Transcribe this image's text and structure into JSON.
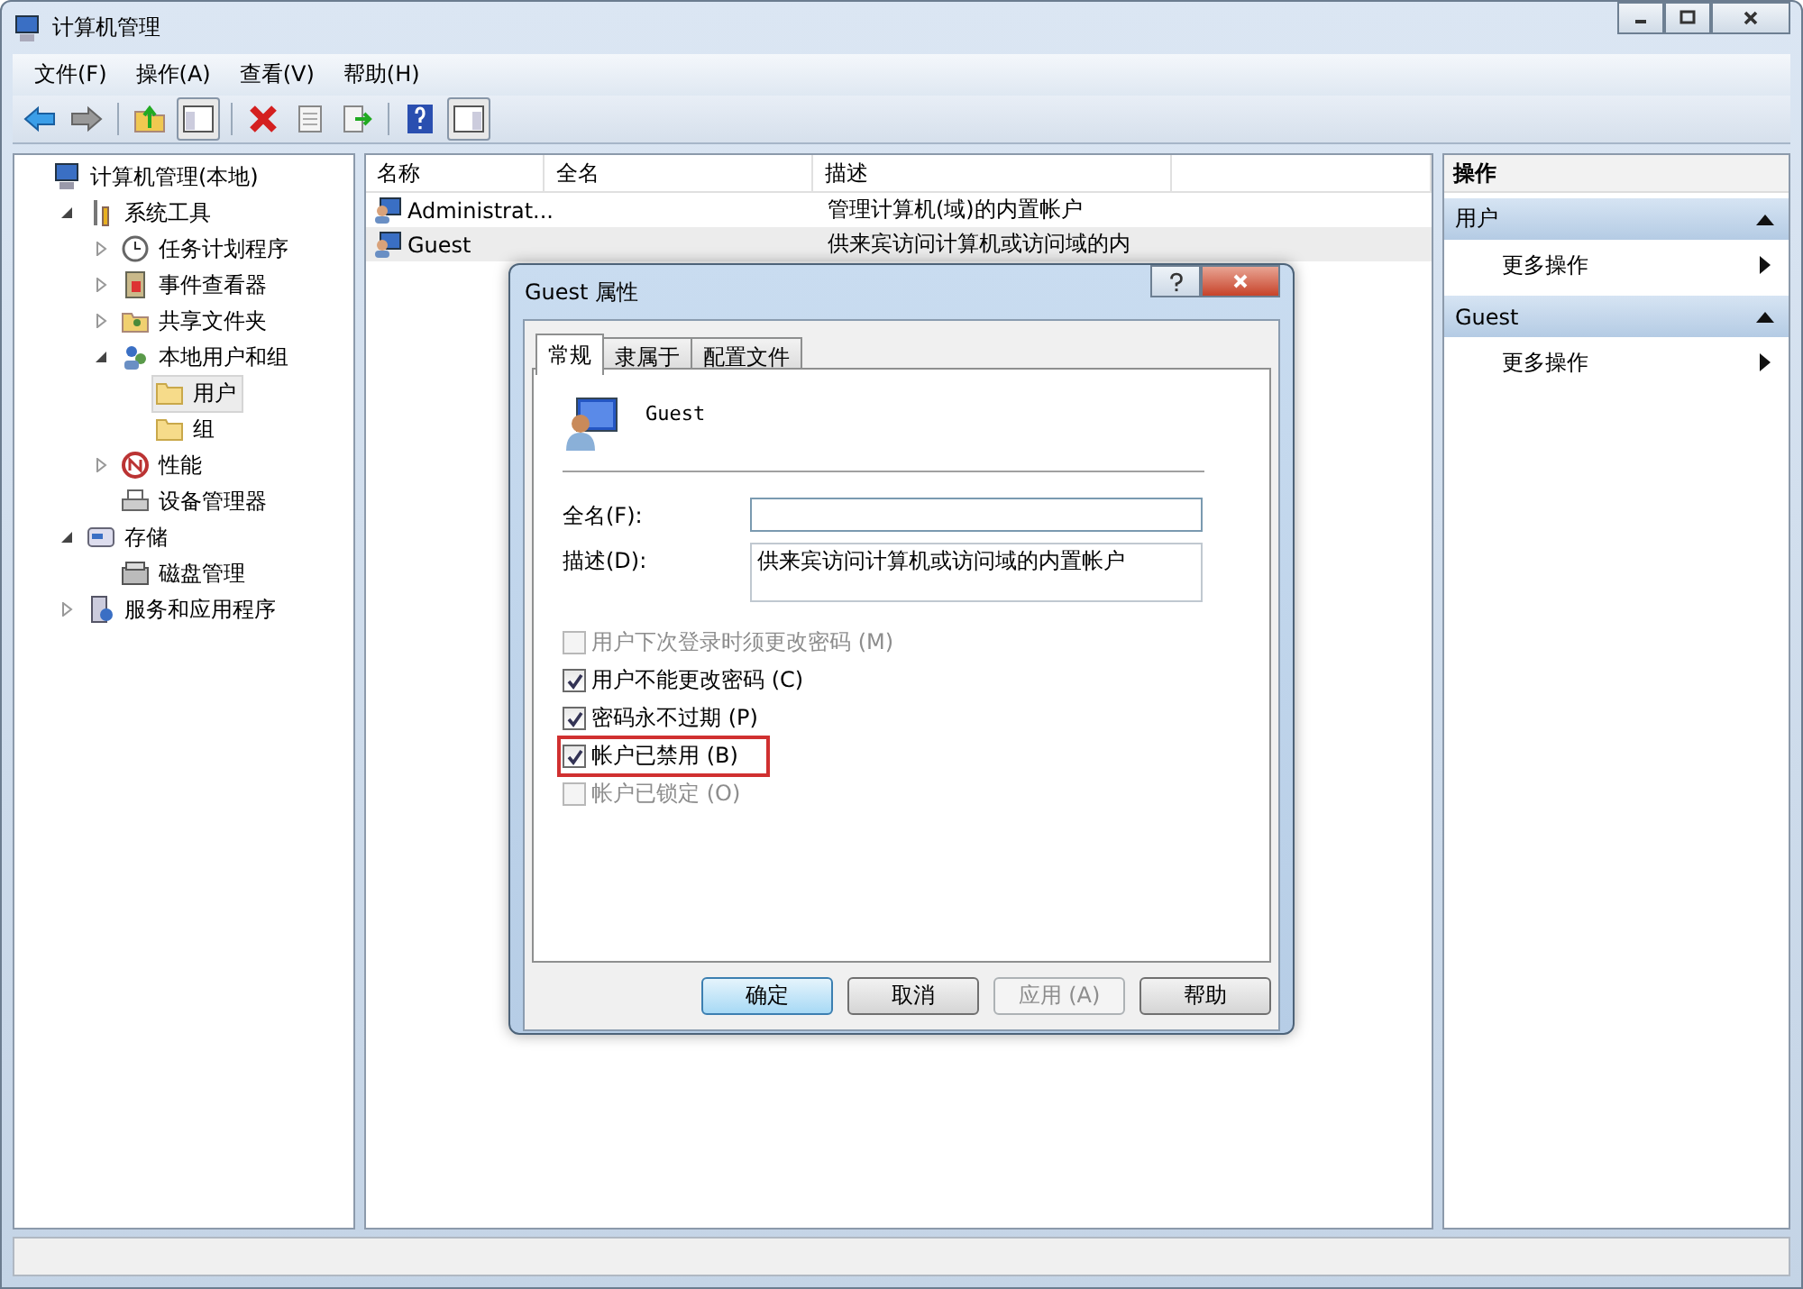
{
  "window": {
    "title": "计算机管理"
  },
  "menu": [
    "文件(F)",
    "操作(A)",
    "查看(V)",
    "帮助(H)"
  ],
  "tree": [
    {
      "label": "计算机管理(本地)",
      "kind": "computer",
      "selected": false,
      "children": [
        {
          "label": "系统工具",
          "kind": "tools",
          "selected": false,
          "expanded": true,
          "children": [
            {
              "label": "任务计划程序",
              "kind": "clock",
              "selected": false,
              "expanded": false
            },
            {
              "label": "事件查看器",
              "kind": "log",
              "selected": false,
              "expanded": false
            },
            {
              "label": "共享文件夹",
              "kind": "share",
              "selected": false,
              "expanded": false
            },
            {
              "label": "本地用户和组",
              "kind": "users",
              "selected": false,
              "expanded": true,
              "children": [
                {
                  "label": "用户",
                  "kind": "folder",
                  "selected": true
                },
                {
                  "label": "组",
                  "kind": "folder",
                  "selected": false
                }
              ]
            },
            {
              "label": "性能",
              "kind": "perf",
              "selected": false,
              "expanded": false
            },
            {
              "label": "设备管理器",
              "kind": "device",
              "selected": false
            }
          ]
        },
        {
          "label": "存储",
          "kind": "storage",
          "selected": false,
          "expanded": true,
          "children": [
            {
              "label": "磁盘管理",
              "kind": "disk",
              "selected": false
            }
          ]
        },
        {
          "label": "服务和应用程序",
          "kind": "services",
          "selected": false,
          "expanded": false
        }
      ]
    }
  ],
  "table": {
    "columns": [
      "名称",
      "全名",
      "描述"
    ],
    "rows": [
      {
        "name": "Administrat...",
        "description": "管理计算机(域)的内置帐户",
        "selected": false
      },
      {
        "name": "Guest",
        "description": "供来宾访问计算机或访问域的内",
        "selected": true
      }
    ]
  },
  "actions": {
    "title": "操作",
    "sections": [
      {
        "title": "用户",
        "items": [
          "更多操作"
        ]
      },
      {
        "title": "Guest",
        "items": [
          "更多操作"
        ]
      }
    ]
  },
  "dialog": {
    "title": "Guest 属性",
    "tabs": [
      {
        "label": "常规",
        "selected": true
      },
      {
        "label": "隶属于",
        "selected": false
      },
      {
        "label": "配置文件",
        "selected": false
      }
    ],
    "user_name": "Guest",
    "full_name": {
      "label": "全名(F):"
    },
    "description": {
      "label": "描述(D):",
      "value": "供来宾访问计算机或访问域的内置帐户"
    },
    "options": [
      {
        "label": "用户下次登录时须更改密码 (M)",
        "checked": false,
        "disabled": true,
        "highlighted": false
      },
      {
        "label": "用户不能更改密码 (C)",
        "checked": true,
        "disabled": false,
        "highlighted": false
      },
      {
        "label": "密码永不过期 (P)",
        "checked": true,
        "disabled": false,
        "highlighted": false
      },
      {
        "label": "帐户已禁用 (B)",
        "checked": true,
        "disabled": false,
        "highlighted": true
      },
      {
        "label": "帐户已锁定 (O)",
        "checked": false,
        "disabled": true,
        "highlighted": false
      }
    ],
    "buttons": [
      {
        "label": "确定",
        "default": true,
        "disabled": false
      },
      {
        "label": "取消",
        "default": false,
        "disabled": false
      },
      {
        "label": "应用 (A)",
        "default": false,
        "disabled": true
      },
      {
        "label": "帮助",
        "default": false,
        "disabled": false
      }
    ]
  }
}
